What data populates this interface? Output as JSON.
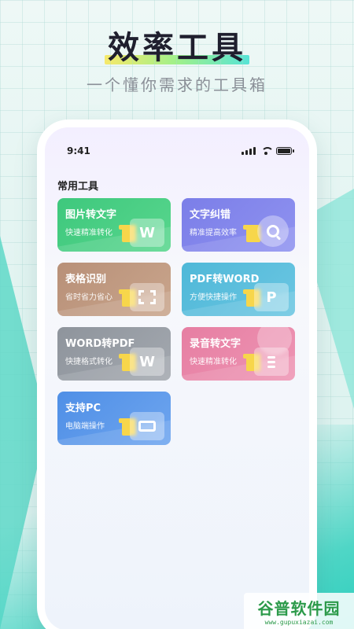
{
  "hero": {
    "title": "效率工具",
    "subtitle": "一个懂你需求的工具箱"
  },
  "status_bar": {
    "time": "9:41",
    "icons": [
      "signal-icon",
      "wifi-icon",
      "battery-icon"
    ]
  },
  "section": {
    "title": "常用工具"
  },
  "tools": [
    {
      "title": "图片转文字",
      "subtitle": "快速精准转化",
      "glyph": "W",
      "color": "#3ec87d"
    },
    {
      "title": "文字纠错",
      "subtitle": "精准提高效率",
      "glyph": "",
      "color": "#7b7ee8"
    },
    {
      "title": "表格识别",
      "subtitle": "省时省力省心",
      "glyph": "",
      "color": "#b89078"
    },
    {
      "title": "PDF转WORD",
      "subtitle": "方便快捷操作",
      "glyph": "P",
      "color": "#4fb8d8"
    },
    {
      "title": "WORD转PDF",
      "subtitle": "快捷格式转化",
      "glyph": "W",
      "color": "#8e949c"
    },
    {
      "title": "录音转文字",
      "subtitle": "快速精准转化",
      "glyph": "",
      "color": "#e67ea2"
    },
    {
      "title": "支持PC",
      "subtitle": "电脑端操作",
      "glyph": "",
      "color": "#4f8fe6"
    }
  ],
  "watermark": {
    "name": "谷普软件园",
    "url": "www.gupuxiazai.com"
  }
}
